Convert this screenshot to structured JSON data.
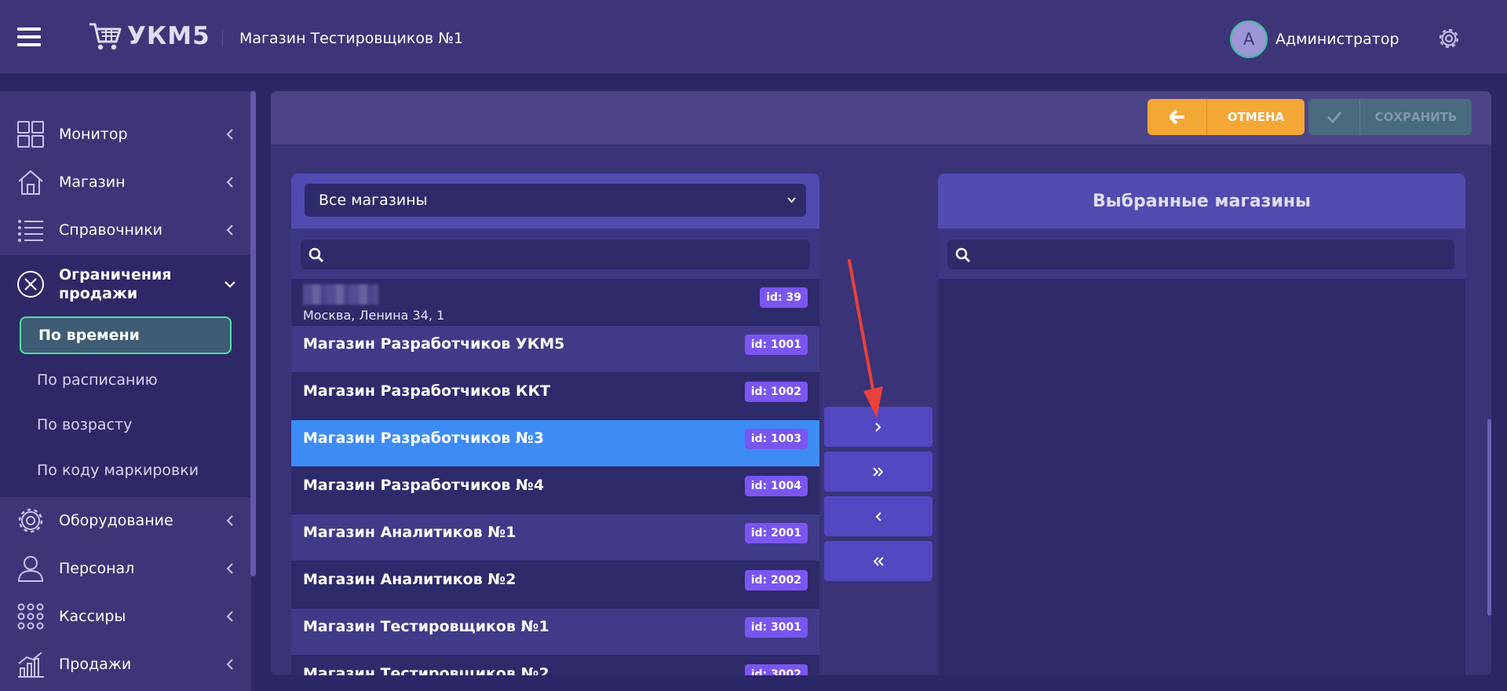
{
  "header": {
    "logo_text": "УКМ5",
    "store_title": "Магазин Тестировщиков №1",
    "user": {
      "avatar_letter": "A",
      "name": "Администратор"
    }
  },
  "sidebar": {
    "items": [
      {
        "label": "Монитор",
        "icon": "dashboard-icon"
      },
      {
        "label": "Магазин",
        "icon": "store-icon"
      },
      {
        "label": "Справочники",
        "icon": "list-icon"
      },
      {
        "label": "Ограничения продажи",
        "icon": "restriction-icon",
        "open": true
      },
      {
        "label": "Оборудование",
        "icon": "gear-icon"
      },
      {
        "label": "Персонал",
        "icon": "person-icon"
      },
      {
        "label": "Кассиры",
        "icon": "grid-icon"
      },
      {
        "label": "Продажи",
        "icon": "chart-icon"
      }
    ],
    "submenu": [
      {
        "label": "По времени",
        "active": true
      },
      {
        "label": "По расписанию"
      },
      {
        "label": "По возрасту"
      },
      {
        "label": "По коду маркировки"
      }
    ]
  },
  "toolbar": {
    "cancel_label": "ОТМЕНА",
    "save_label": "СОХРАНИТЬ"
  },
  "available": {
    "filter_selected": "Все магазины",
    "search_placeholder": "",
    "first_item": {
      "address": "Москва, Ленина 34, 1",
      "badge": "id: 39"
    },
    "items": [
      {
        "name": "Магазин Разработчиков УКМ5",
        "badge": "id: 1001"
      },
      {
        "name": "Магазин Разработчиков ККТ",
        "badge": "id: 1002"
      },
      {
        "name": "Магазин Разработчиков №3",
        "badge": "id: 1003",
        "selected": true
      },
      {
        "name": "Магазин Разработчиков №4",
        "badge": "id: 1004"
      },
      {
        "name": "Магазин Аналитиков №1",
        "badge": "id: 2001"
      },
      {
        "name": "Магазин Аналитиков №2",
        "badge": "id: 2002"
      },
      {
        "name": "Магазин Тестировщиков №1",
        "badge": "id: 3001"
      },
      {
        "name": "Магазин Тестировщиков №2",
        "badge": "id: 3002"
      }
    ]
  },
  "selected": {
    "title": "Выбранные магазины",
    "search_placeholder": ""
  },
  "colors": {
    "accent_cancel": "#f3a735",
    "selected_row": "#3d8bf5",
    "badge": "#7a56f0",
    "active_submenu_border": "#4ee0a0"
  }
}
